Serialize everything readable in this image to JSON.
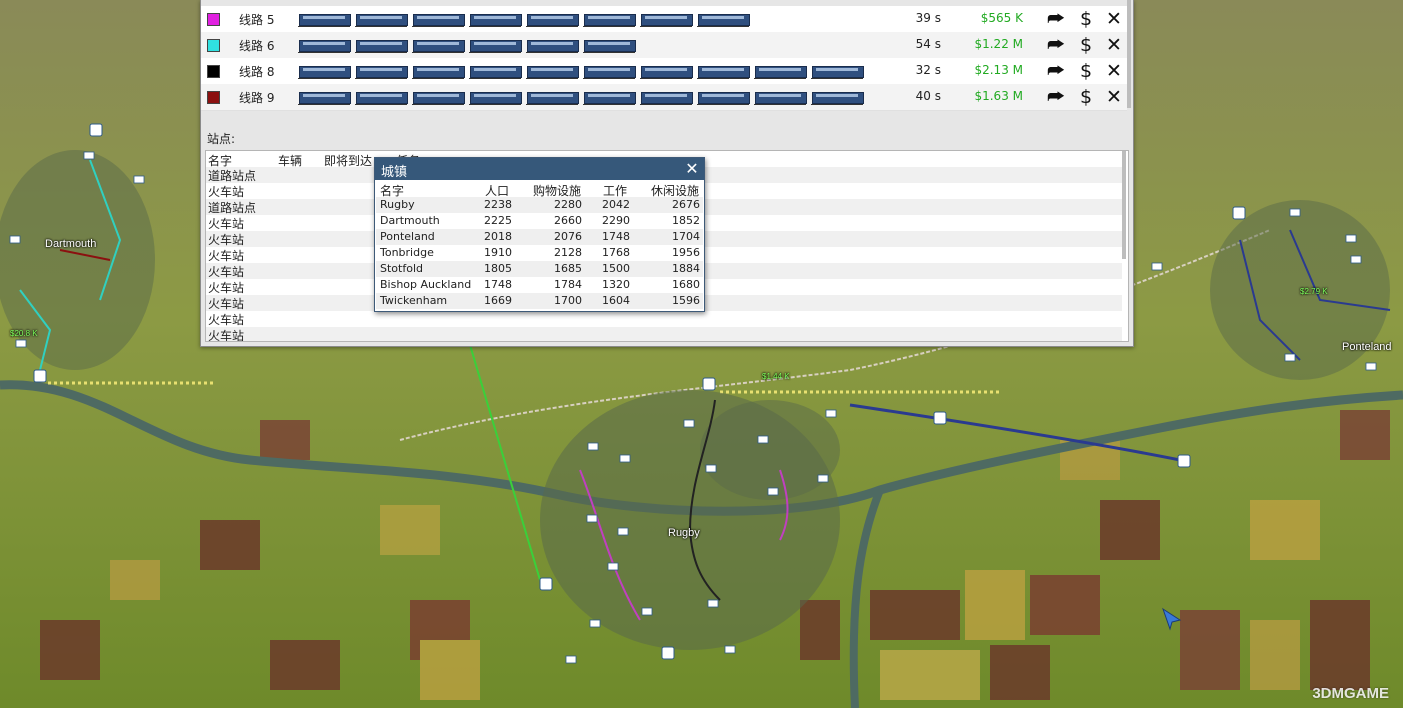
{
  "lines": [
    {
      "name": "线路 5",
      "color": "#e020e0",
      "vehicle_count": 8,
      "time": "39 s",
      "profit": "$565 K"
    },
    {
      "name": "线路 6",
      "color": "#30e0e0",
      "vehicle_count": 6,
      "time": "54 s",
      "profit": "$1.22 M"
    },
    {
      "name": "线路 8",
      "color": "#000000",
      "vehicle_count": 10,
      "time": "32 s",
      "profit": "$2.13 M"
    },
    {
      "name": "线路 9",
      "color": "#8b1010",
      "vehicle_count": 10,
      "time": "40 s",
      "profit": "$1.63 M"
    }
  ],
  "line_actions": {
    "reassign_icon": "reassign-arrow-icon",
    "money_icon": "$",
    "delete_icon": "✕"
  },
  "stations": {
    "label": "站点:",
    "columns": [
      "名字",
      "车辆",
      "即将到达",
      "任务"
    ],
    "rows": [
      "道路站点",
      "火车站",
      "道路站点",
      "火车站",
      "火车站",
      "火车站",
      "火车站",
      "火车站",
      "火车站",
      "火车站",
      "火车站"
    ]
  },
  "town_dialog": {
    "title": "城镇",
    "close": "✕",
    "columns": [
      "名字",
      "人口",
      "购物设施",
      "工作",
      "休闲设施"
    ],
    "rows": [
      {
        "name": "Rugby",
        "population": "2238",
        "shopping": "2280",
        "work": "2042",
        "leisure": "2676"
      },
      {
        "name": "Dartmouth",
        "population": "2225",
        "shopping": "2660",
        "work": "2290",
        "leisure": "1852"
      },
      {
        "name": "Ponteland",
        "population": "2018",
        "shopping": "2076",
        "work": "1748",
        "leisure": "1704"
      },
      {
        "name": "Tonbridge",
        "population": "1910",
        "shopping": "2128",
        "work": "1768",
        "leisure": "1956"
      },
      {
        "name": "Stotfold",
        "population": "1805",
        "shopping": "1685",
        "work": "1500",
        "leisure": "1884"
      },
      {
        "name": "Bishop Auckland",
        "population": "1748",
        "shopping": "1784",
        "work": "1320",
        "leisure": "1680"
      },
      {
        "name": "Twickenham",
        "population": "1669",
        "shopping": "1700",
        "work": "1604",
        "leisure": "1596"
      }
    ]
  },
  "map": {
    "town_labels": [
      "Dartmouth",
      "Rugby",
      "Ponteland"
    ],
    "money_labels": [
      "$20.8 K",
      "$1.44 K",
      "$2.79 K"
    ]
  },
  "watermark": "3DMGAME"
}
